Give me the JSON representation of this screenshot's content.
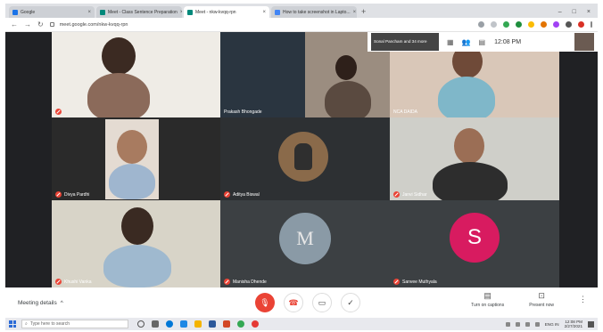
{
  "browser": {
    "tabs": [
      {
        "label": "Google",
        "active": false
      },
      {
        "label": "Meet - Class Sentence Preparation",
        "active": false
      },
      {
        "label": "Meet - nkw-kvqq-rpn",
        "active": true
      },
      {
        "label": "How to take screenshot in Lapto...",
        "active": false
      }
    ],
    "url": "meet.google.com/nkw-kvqq-rpn"
  },
  "meet": {
    "presenter_preview": "Sonal Pancham and 34 more",
    "clock": "12:08 PM",
    "participants": [
      {
        "name": "",
        "kind": "video",
        "muted": true
      },
      {
        "name": "Prakash Bhongade",
        "kind": "video",
        "muted": false
      },
      {
        "name": "NCA DAIDA",
        "kind": "video",
        "muted": false
      },
      {
        "name": "Divya Pardhi",
        "kind": "video",
        "muted": true
      },
      {
        "name": "Aditya Biswal",
        "kind": "avatar",
        "muted": true
      },
      {
        "name": "Janvi Sidhar",
        "kind": "video",
        "muted": true
      },
      {
        "name": "Khushi Vanka",
        "kind": "video",
        "muted": true
      },
      {
        "name": "Manisha Dhende",
        "kind": "avatar",
        "initials": "M",
        "muted": true
      },
      {
        "name": "Sanvee Muthyala",
        "kind": "letter",
        "letter": "S",
        "muted": true
      }
    ]
  },
  "controls": {
    "meeting_details": "Meeting details",
    "captions_label": "Turn on captions",
    "present_label": "Present now"
  },
  "taskbar": {
    "search_placeholder": "Type here to search",
    "time": "12:08 PM",
    "date": "2/27/2021",
    "lang": "ENG IN"
  },
  "colors": {
    "stage_bg": "#202124",
    "tile_bg": "#3c4043",
    "danger": "#ea4335",
    "avatar_s": "#d81b60"
  }
}
